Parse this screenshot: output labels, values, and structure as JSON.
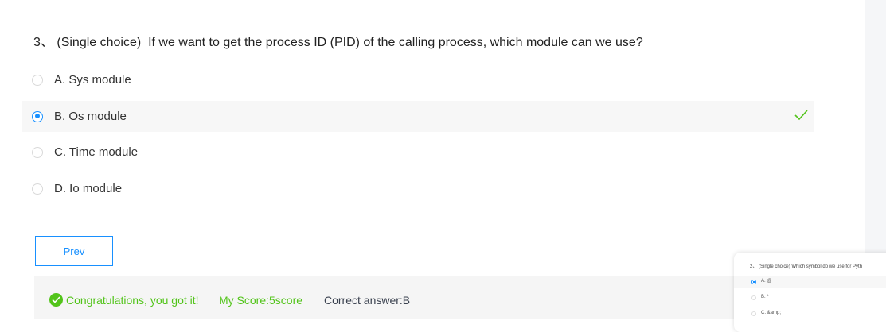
{
  "question": {
    "number": "3、",
    "type": "(Single choice)",
    "text": "If we want to get the process ID (PID) of the calling process, which module can we use?"
  },
  "options": [
    {
      "label": "A. Sys module",
      "selected": false
    },
    {
      "label": "B. Os module",
      "selected": true,
      "correct": true
    },
    {
      "label": "C. Time module",
      "selected": false
    },
    {
      "label": "D. Io module",
      "selected": false
    }
  ],
  "nav": {
    "prev_label": "Prev"
  },
  "result": {
    "message": "Congratulations, you got it!",
    "score": "My Score:5score",
    "correct_answer": "Correct answer:B"
  },
  "preview": {
    "question": "2、 (Single choice) Which symbol do we use for Pyth",
    "options": [
      {
        "label": "A. @",
        "selected": true
      },
      {
        "label": "B. *",
        "selected": false
      },
      {
        "label": "C. &amp;",
        "selected": false
      }
    ]
  },
  "colors": {
    "accent": "#1890ff",
    "success": "#52c41a"
  }
}
